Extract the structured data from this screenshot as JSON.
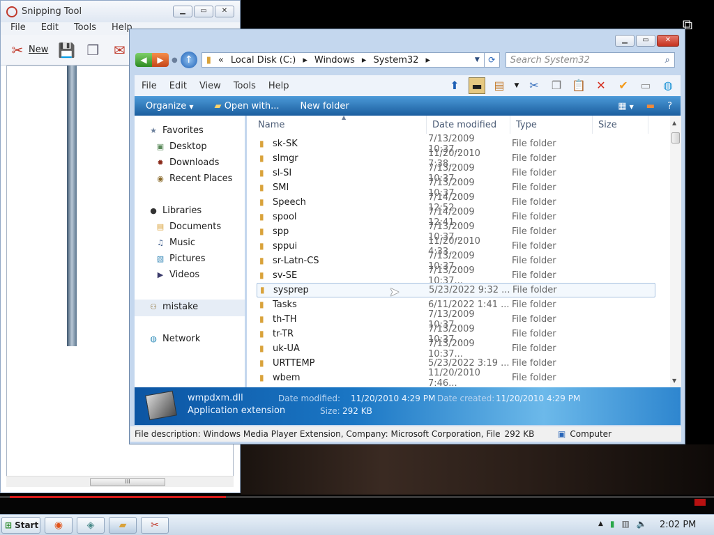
{
  "snipping_tool": {
    "title": "Snipping Tool",
    "menu": [
      "File",
      "Edit",
      "Tools",
      "Help"
    ],
    "new_label": "New",
    "scroll_thumb_label": "III"
  },
  "explorer": {
    "breadcrumb": [
      "«",
      "Local Disk (C:)",
      "Windows",
      "System32"
    ],
    "search_placeholder": "Search System32",
    "menu": [
      "File",
      "Edit",
      "View",
      "Tools",
      "Help"
    ],
    "commands": {
      "organize": "Organize",
      "open_with": "Open with...",
      "new_folder": "New folder"
    },
    "nav": {
      "favorites": "Favorites",
      "desktop": "Desktop",
      "downloads": "Downloads",
      "recent_places": "Recent Places",
      "libraries": "Libraries",
      "documents": "Documents",
      "music": "Music",
      "pictures": "Pictures",
      "videos": "Videos",
      "mistake": "mistake",
      "network": "Network"
    },
    "columns": [
      "Name",
      "Date modified",
      "Type",
      "Size"
    ],
    "rows": [
      {
        "name": "sk-SK",
        "date": "7/13/2009 10:37...",
        "type": "File folder"
      },
      {
        "name": "slmgr",
        "date": "11/20/2010 7:38...",
        "type": "File folder"
      },
      {
        "name": "sl-SI",
        "date": "7/13/2009 10:37...",
        "type": "File folder"
      },
      {
        "name": "SMI",
        "date": "7/13/2009 10:37...",
        "type": "File folder"
      },
      {
        "name": "Speech",
        "date": "7/14/2009 12:52...",
        "type": "File folder"
      },
      {
        "name": "spool",
        "date": "7/14/2009 12:41...",
        "type": "File folder"
      },
      {
        "name": "spp",
        "date": "7/13/2009 10:37...",
        "type": "File folder"
      },
      {
        "name": "sppui",
        "date": "11/20/2010 4:33...",
        "type": "File folder"
      },
      {
        "name": "sr-Latn-CS",
        "date": "7/13/2009 10:37...",
        "type": "File folder"
      },
      {
        "name": "sv-SE",
        "date": "7/13/2009 10:37...",
        "type": "File folder"
      },
      {
        "name": "sysprep",
        "date": "5/23/2022 9:32 ...",
        "type": "File folder"
      },
      {
        "name": "Tasks",
        "date": "6/11/2022 1:41 ...",
        "type": "File folder"
      },
      {
        "name": "th-TH",
        "date": "7/13/2009 10:37...",
        "type": "File folder"
      },
      {
        "name": "tr-TR",
        "date": "7/13/2009 10:37...",
        "type": "File folder"
      },
      {
        "name": "uk-UA",
        "date": "7/13/2009 10:37...",
        "type": "File folder"
      },
      {
        "name": "URTTEMP",
        "date": "5/23/2022 3:19 ...",
        "type": "File folder"
      },
      {
        "name": "wbem",
        "date": "11/20/2010 7:46...",
        "type": "File folder"
      }
    ],
    "selected_row": "sysprep",
    "details": {
      "filename": "wmpdxm.dll",
      "filetype": "Application extension",
      "date_modified_label": "Date modified:",
      "date_modified": "11/20/2010 4:29 PM",
      "date_created_label": "Date created:",
      "date_created": "11/20/2010 4:29 PM",
      "size_label": "Size:",
      "size": "292 KB"
    },
    "status": {
      "description": "File description: Windows Media Player Extension, Company: Microsoft Corporation, File",
      "size": "292 KB",
      "location": "Computer"
    }
  },
  "taskbar": {
    "start_label": "Start",
    "clock": "2:02 PM"
  },
  "video": {
    "progress_fraction": 0.3
  }
}
